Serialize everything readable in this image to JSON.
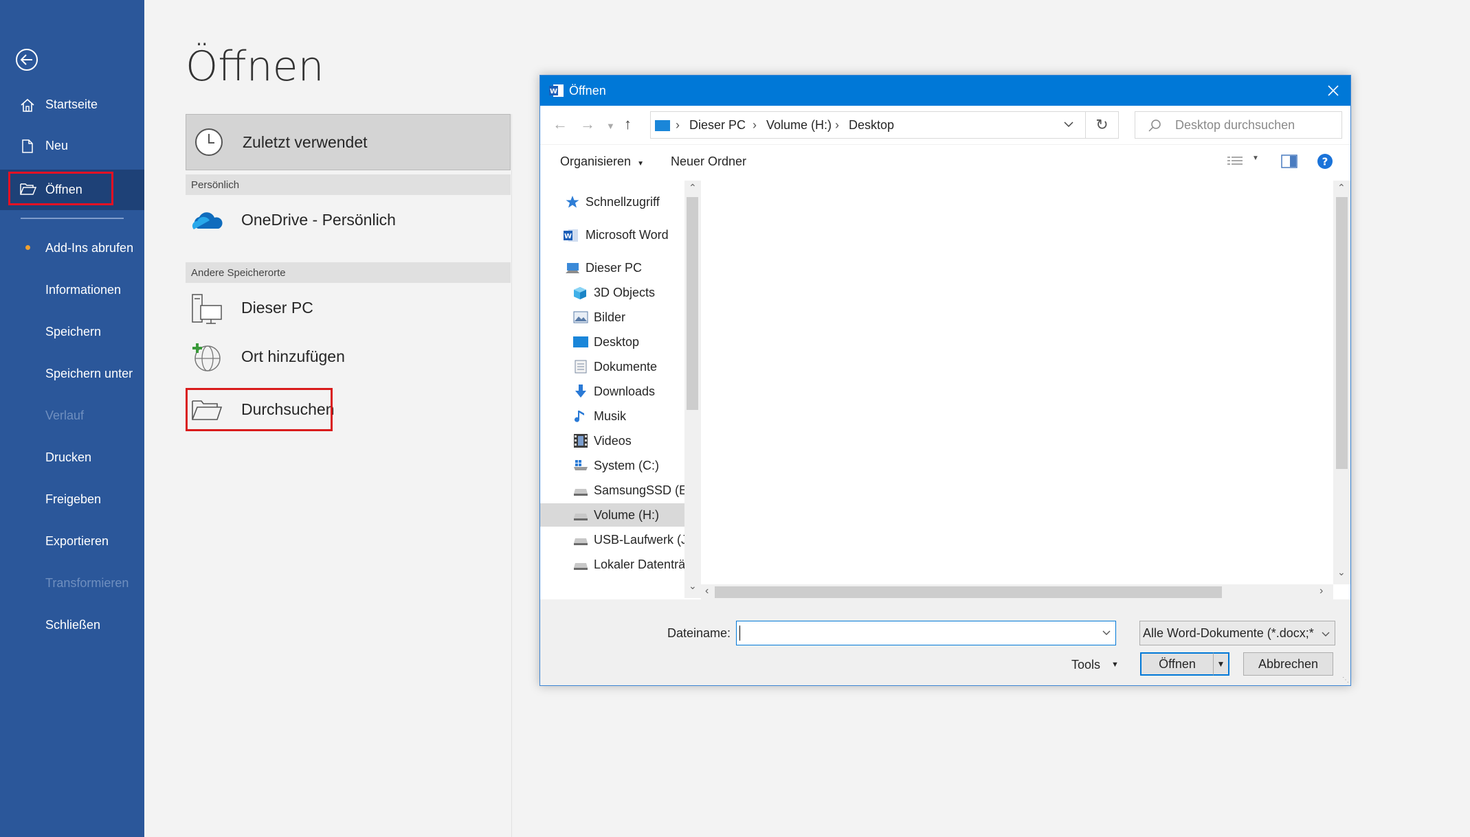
{
  "sidebar": {
    "items": [
      {
        "label": "Startseite"
      },
      {
        "label": "Neu"
      },
      {
        "label": "Öffnen"
      },
      {
        "label": "Add-Ins abrufen"
      },
      {
        "label": "Informationen"
      },
      {
        "label": "Speichern"
      },
      {
        "label": "Speichern unter"
      },
      {
        "label": "Verlauf"
      },
      {
        "label": "Drucken"
      },
      {
        "label": "Freigeben"
      },
      {
        "label": "Exportieren"
      },
      {
        "label": "Transformieren"
      },
      {
        "label": "Schließen"
      }
    ]
  },
  "page": {
    "title": "Öffnen"
  },
  "places": {
    "recent": "Zuletzt verwendet",
    "section_personal": "Persönlich",
    "onedrive": "OneDrive - Persönlich",
    "section_other": "Andere Speicherorte",
    "this_pc": "Dieser PC",
    "add_place": "Ort hinzufügen",
    "browse": "Durchsuchen"
  },
  "dialog": {
    "title": "Öffnen",
    "breadcrumb": [
      "Dieser PC",
      "Volume (H:)",
      "Desktop"
    ],
    "search_placeholder": "Desktop durchsuchen",
    "toolbar": {
      "organize": "Organisieren",
      "new_folder": "Neuer Ordner"
    },
    "tree": [
      {
        "label": "Schnellzugriff",
        "icon": "star-icon"
      },
      {
        "label": "Microsoft Word",
        "icon": "word-icon"
      },
      {
        "label": "Dieser PC",
        "icon": "computer-icon"
      },
      {
        "label": "3D Objects",
        "icon": "cube-icon"
      },
      {
        "label": "Bilder",
        "icon": "pictures-icon"
      },
      {
        "label": "Desktop",
        "icon": "desktop-icon"
      },
      {
        "label": "Dokumente",
        "icon": "documents-icon"
      },
      {
        "label": "Downloads",
        "icon": "download-icon"
      },
      {
        "label": "Musik",
        "icon": "music-icon"
      },
      {
        "label": "Videos",
        "icon": "videos-icon"
      },
      {
        "label": "System (C:)",
        "icon": "drive-icon"
      },
      {
        "label": "SamsungSSD (E:",
        "icon": "drive-icon"
      },
      {
        "label": "Volume (H:)",
        "icon": "drive-icon"
      },
      {
        "label": "USB-Laufwerk (J:",
        "icon": "drive-icon"
      },
      {
        "label": "Lokaler Datenträ",
        "icon": "drive-icon"
      }
    ],
    "filename_label": "Dateiname:",
    "filename_value": "",
    "filetype": "Alle Word-Dokumente (*.docx;*",
    "tools": "Tools",
    "open_button": "Öffnen",
    "cancel_button": "Abbrechen"
  },
  "colors": {
    "sidebar": "#2b579a",
    "accent": "#0078d7",
    "highlight": "#e81123"
  }
}
